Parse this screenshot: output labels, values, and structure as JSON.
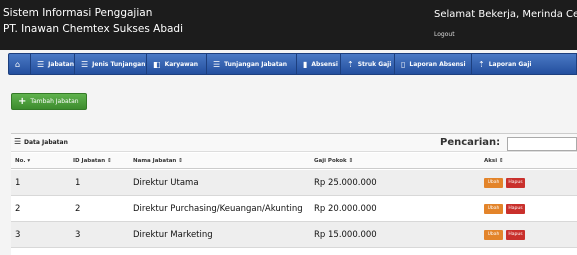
{
  "header": {
    "title": "Sistem Informasi Penggajian",
    "company": "PT. Inawan Chemtex Sukses Abadi",
    "welcome": "Selamat Bekerja, Merinda Cecilia",
    "logout": "Logout"
  },
  "nav": [
    {
      "label": "",
      "icon": "home-icon",
      "glyph": "⌂"
    },
    {
      "label": "Jabatan",
      "icon": "list-icon",
      "glyph": "☰"
    },
    {
      "label": "Jenis Tunjangan",
      "icon": "list-icon",
      "glyph": "☰"
    },
    {
      "label": "Karyawan",
      "icon": "user-icon",
      "glyph": "◧"
    },
    {
      "label": "Tunjangan Jabatan",
      "icon": "list-icon",
      "glyph": "☰"
    },
    {
      "label": "Absensi",
      "icon": "document-icon",
      "glyph": "▮"
    },
    {
      "label": "Struk Gaji",
      "icon": "money-icon",
      "glyph": "⇡"
    },
    {
      "label": "Laporan Absensi",
      "icon": "document-icon",
      "glyph": "▯"
    },
    {
      "label": "Laporan Gaji",
      "icon": "money-icon",
      "glyph": "⇡"
    }
  ],
  "add_button": "Tambah Jabatan",
  "panel": {
    "title": "Data Jabatan",
    "search_label": "Pencarian:",
    "columns": [
      "No.",
      "ID Jabatan",
      "Nama Jabatan",
      "Gaji Pokok",
      "Aksi"
    ],
    "rows": [
      {
        "no": "1",
        "id": "1",
        "nama": "Direktur Utama",
        "gaji": "Rp 25.000.000"
      },
      {
        "no": "2",
        "id": "2",
        "nama": "Direktur Purchasing/Keuangan/Akunting",
        "gaji": "Rp 20.000.000"
      },
      {
        "no": "3",
        "id": "3",
        "nama": "Direktur Marketing",
        "gaji": "Rp 15.000.000"
      }
    ],
    "edit_label": "Ubah",
    "delete_label": "Hapus"
  }
}
